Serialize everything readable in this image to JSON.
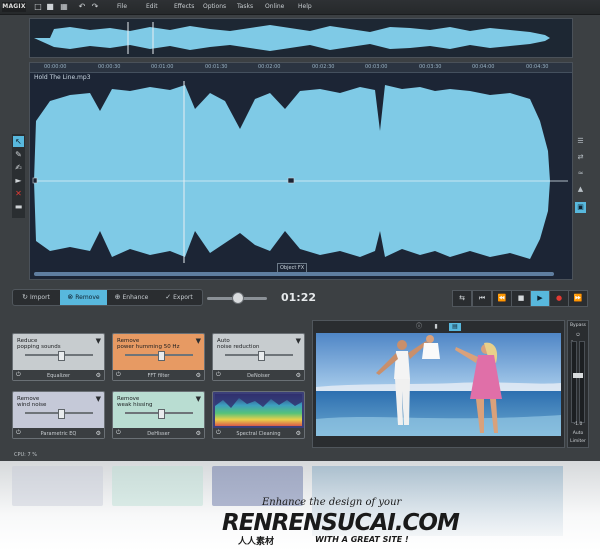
{
  "app": {
    "logo": "MAGIX"
  },
  "menu": {
    "items": [
      "File",
      "Edit",
      "Effects",
      "Options",
      "Tasks",
      "Online",
      "Help"
    ]
  },
  "toolbar": {
    "icons": [
      "file-icon",
      "open-folder-icon",
      "save-icon",
      "undo-icon",
      "redo-icon"
    ]
  },
  "editor": {
    "filename": "Hold The Line.mp3",
    "ruler_ticks": [
      "00:00:00",
      "00:00:30",
      "00:01:00",
      "00:01:30",
      "00:02:00",
      "00:02:30",
      "00:03:00",
      "00:03:30",
      "00:04:00",
      "00:04:30"
    ],
    "object_fx": "Object FX"
  },
  "modes": {
    "items": [
      "Import",
      "Remove",
      "Enhance",
      "Export"
    ],
    "active": "Remove"
  },
  "position": {
    "time": "01:22"
  },
  "transport": {
    "icons": [
      "loop-icon",
      "go-to-start-icon",
      "rewind-icon",
      "stop-icon",
      "play-icon",
      "record-icon",
      "fast-forward-icon"
    ]
  },
  "modules": [
    {
      "title_1": "Reduce",
      "title_2": "popping sounds",
      "name": "Equalizer",
      "color": "#c7cccf"
    },
    {
      "title_1": "Remove",
      "title_2": "power humming 50 Hz",
      "name": "FFT filter",
      "color": "#e79a63"
    },
    {
      "title_1": "Auto",
      "title_2": "noise reduction",
      "name": "DeNoiser",
      "color": "#c7cccf"
    },
    {
      "title_1": "Remove",
      "title_2": "wind noise",
      "name": "Parametric EQ",
      "color": "#c5c9d8"
    },
    {
      "title_1": "Remove",
      "title_2": "weak hissing",
      "name": "DeHisser",
      "color": "#b9ddd2"
    },
    {
      "title_1": "",
      "title_2": "",
      "name": "Spectral Cleaning",
      "color": "#3b3f79"
    }
  ],
  "bypass": {
    "label": "Bypass",
    "scale_top": "0",
    "scale_bottom": "-1.0",
    "auto": "Auto",
    "limiter": "Limiter"
  },
  "status": {
    "cpu": "CPU: 7 %"
  },
  "watermark": {
    "line1": "Enhance the design of your",
    "brand": "RENRENSUCAI.COM",
    "cn": "人人素材",
    "line2": "WITH A GREAT SITE !"
  },
  "colors": {
    "accent": "#58b8dd",
    "waveform": "#7fcae6",
    "background": "#3c4043"
  }
}
